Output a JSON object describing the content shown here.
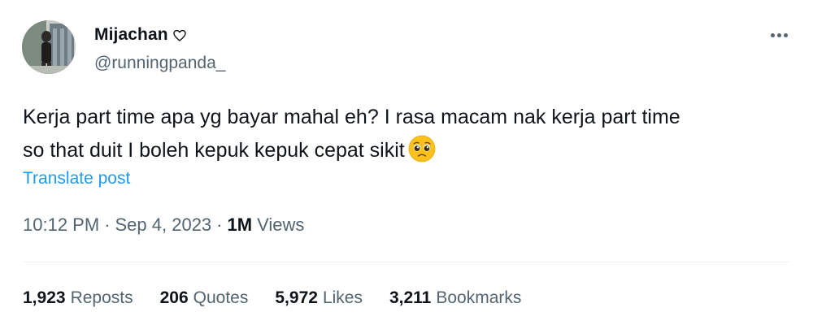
{
  "user": {
    "display_name": "Mijachan",
    "name_badge_icon": "heart-outline-icon",
    "handle": "@runningpanda_"
  },
  "more_icon": "more-horizontal-icon",
  "post": {
    "text_line_1": "Kerja part time apa yg bayar mahal eh? I rasa macam nak kerja part time",
    "text_line_2": "so that duit I boleh kepuk kepuk cepat sikit",
    "emoji": "pleading-face-emoji",
    "translate_label": "Translate post"
  },
  "meta": {
    "time": "10:12 PM",
    "separator": "·",
    "date": "Sep 4, 2023",
    "views_count": "1M",
    "views_label": "Views"
  },
  "stats": {
    "reposts": {
      "value": "1,923",
      "label": "Reposts"
    },
    "quotes": {
      "value": "206",
      "label": "Quotes"
    },
    "likes": {
      "value": "5,972",
      "label": "Likes"
    },
    "bookmarks": {
      "value": "3,211",
      "label": "Bookmarks"
    }
  },
  "colors": {
    "text_primary": "#0f1419",
    "text_secondary": "#536471",
    "link": "#1d9bf0",
    "divider": "#eff3f4"
  }
}
